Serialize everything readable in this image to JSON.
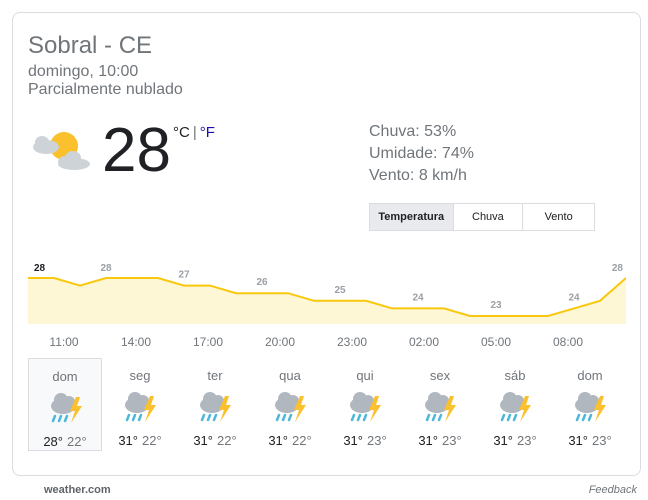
{
  "location": "Sobral - CE",
  "datetime": "domingo, 10:00",
  "condition": "Parcialmente nublado",
  "current": {
    "temperature": "28",
    "unit_c": "°C",
    "unit_separator": "|",
    "unit_f": "°F",
    "icon": "partly-cloudy-icon"
  },
  "stats": {
    "rain": "Chuva: 53%",
    "humidity": "Umidade: 74%",
    "wind": "Vento: 8 km/h"
  },
  "tabs": [
    {
      "label": "Temperatura",
      "active": true
    },
    {
      "label": "Chuva",
      "active": false
    },
    {
      "label": "Vento",
      "active": false
    }
  ],
  "chart_data": {
    "type": "area",
    "x": [
      "10:00",
      "11:00",
      "12:00",
      "13:00",
      "14:00",
      "15:00",
      "16:00",
      "17:00",
      "18:00",
      "19:00",
      "20:00",
      "21:00",
      "22:00",
      "23:00",
      "00:00",
      "01:00",
      "02:00",
      "03:00",
      "04:00",
      "05:00",
      "06:00",
      "07:00",
      "08:00",
      "09:00"
    ],
    "values": [
      28,
      28,
      27,
      28,
      28,
      28,
      27,
      27,
      26,
      26,
      26,
      25,
      25,
      25,
      24,
      24,
      24,
      23,
      23,
      23,
      23,
      24,
      25,
      28
    ],
    "labels": [
      {
        "index": 0,
        "text": "28"
      },
      {
        "index": 3,
        "text": "28"
      },
      {
        "index": 6,
        "text": "27"
      },
      {
        "index": 9,
        "text": "26"
      },
      {
        "index": 12,
        "text": "25"
      },
      {
        "index": 15,
        "text": "24"
      },
      {
        "index": 18,
        "text": "23"
      },
      {
        "index": 21,
        "text": "24"
      },
      {
        "index": 23,
        "text": "28"
      }
    ],
    "x_tick_labels": [
      "11:00",
      "14:00",
      "17:00",
      "20:00",
      "23:00",
      "02:00",
      "05:00",
      "08:00"
    ],
    "line_color": "#f9c80e",
    "fill_color": "#fef7d6"
  },
  "forecast": [
    {
      "day": "dom",
      "high": "28°",
      "low": "22°",
      "icon": "thunderstorm-icon",
      "selected": true
    },
    {
      "day": "seg",
      "high": "31°",
      "low": "22°",
      "icon": "thunderstorm-icon",
      "selected": false
    },
    {
      "day": "ter",
      "high": "31°",
      "low": "22°",
      "icon": "thunderstorm-icon",
      "selected": false
    },
    {
      "day": "qua",
      "high": "31°",
      "low": "22°",
      "icon": "thunderstorm-icon",
      "selected": false
    },
    {
      "day": "qui",
      "high": "31°",
      "low": "23°",
      "icon": "thunderstorm-icon",
      "selected": false
    },
    {
      "day": "sex",
      "high": "31°",
      "low": "23°",
      "icon": "thunderstorm-icon",
      "selected": false
    },
    {
      "day": "sáb",
      "high": "31°",
      "low": "23°",
      "icon": "thunderstorm-icon",
      "selected": false
    },
    {
      "day": "dom",
      "high": "31°",
      "low": "23°",
      "icon": "thunderstorm-icon",
      "selected": false
    }
  ],
  "footer": {
    "source": "weather.com",
    "feedback": "Feedback"
  }
}
